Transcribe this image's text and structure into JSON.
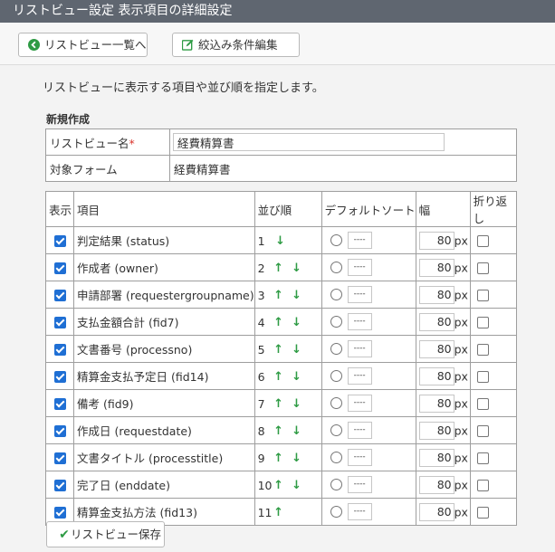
{
  "title": "リストビュー設定 表示項目の詳細設定",
  "toolbar": {
    "back_label": "リストビュー一覧へ",
    "filter_label": "絞込み条件編集"
  },
  "description": "リストビューに表示する項目や並び順を指定します。",
  "section_title": "新規作成",
  "form": {
    "name_label": "リストビュー名",
    "required_mark": "*",
    "name_value": "経費精算書",
    "target_label": "対象フォーム",
    "target_value": "経費精算書"
  },
  "columns": {
    "show": "表示",
    "item": "項目",
    "order": "並び順",
    "default_sort": "デフォルトソート",
    "width": "幅",
    "wrap": "折り返し"
  },
  "sort_placeholder": "----",
  "width_unit": "px",
  "rows": [
    {
      "show": true,
      "item": "判定結果 (status)",
      "order": "1",
      "up": false,
      "down": true,
      "width": "80",
      "wrap": false
    },
    {
      "show": true,
      "item": "作成者 (owner)",
      "order": "2",
      "up": true,
      "down": true,
      "width": "80",
      "wrap": false
    },
    {
      "show": true,
      "item": "申請部署 (requestergroupname)",
      "order": "3",
      "up": true,
      "down": true,
      "width": "80",
      "wrap": false
    },
    {
      "show": true,
      "item": "支払金額合計 (fid7)",
      "order": "4",
      "up": true,
      "down": true,
      "width": "80",
      "wrap": false
    },
    {
      "show": true,
      "item": "文書番号 (processno)",
      "order": "5",
      "up": true,
      "down": true,
      "width": "80",
      "wrap": false
    },
    {
      "show": true,
      "item": "精算金支払予定日 (fid14)",
      "order": "6",
      "up": true,
      "down": true,
      "width": "80",
      "wrap": false
    },
    {
      "show": true,
      "item": "備考 (fid9)",
      "order": "7",
      "up": true,
      "down": true,
      "width": "80",
      "wrap": false
    },
    {
      "show": true,
      "item": "作成日 (requestdate)",
      "order": "8",
      "up": true,
      "down": true,
      "width": "80",
      "wrap": false
    },
    {
      "show": true,
      "item": "文書タイトル (processtitle)",
      "order": "9",
      "up": true,
      "down": true,
      "width": "80",
      "wrap": false
    },
    {
      "show": true,
      "item": "完了日 (enddate)",
      "order": "10",
      "up": true,
      "down": true,
      "width": "80",
      "wrap": false
    },
    {
      "show": true,
      "item": "精算金支払方法 (fid13)",
      "order": "11",
      "up": true,
      "down": false,
      "width": "80",
      "wrap": false
    }
  ],
  "save_label": "リストビュー保存",
  "colors": {
    "accent_green": "#2e9b44",
    "checkbox_blue": "#1f6fd4",
    "titlebar": "#5f6670"
  }
}
